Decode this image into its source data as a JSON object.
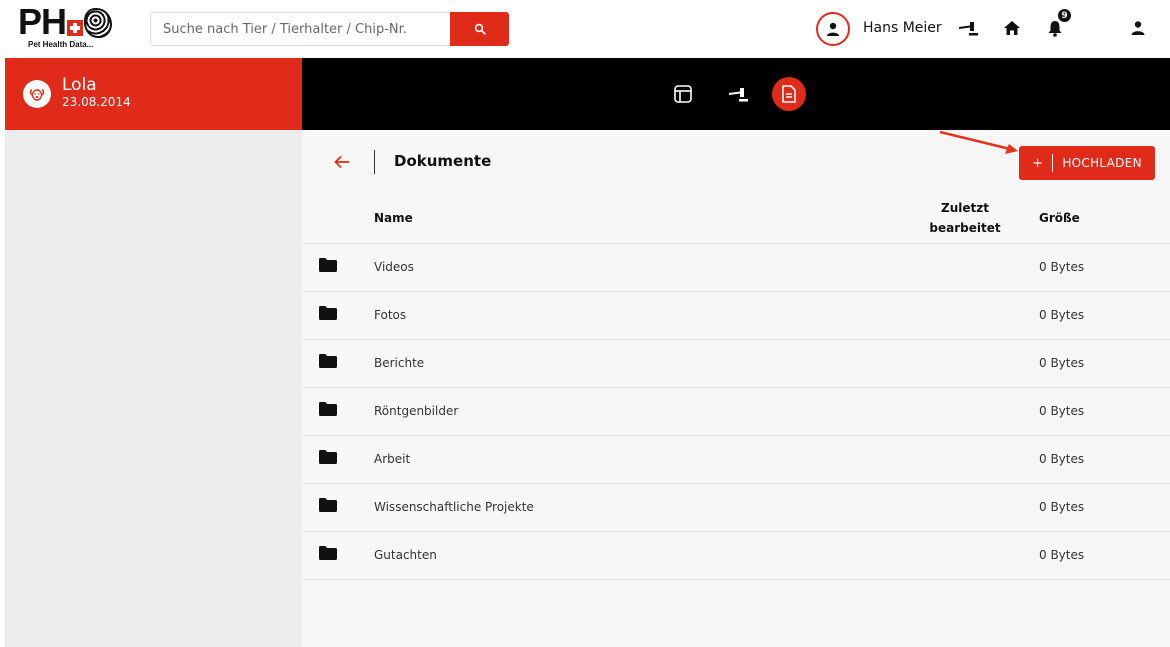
{
  "header": {
    "logo_text": "PH",
    "logo_subtitle": "Pet Health Data...",
    "search_placeholder": "Suche nach Tier / Tierhalter / Chip-Nr.",
    "user_name": "Hans Meier",
    "notification_count": "9",
    "accent_color": "#e02a1a"
  },
  "pet": {
    "name": "Lola",
    "birth_date": "23.08.2014"
  },
  "nav": {
    "items": [
      "dashboard-icon",
      "treatment-icon",
      "documents-icon"
    ],
    "active": "documents-icon"
  },
  "page": {
    "title": "Dokumente",
    "upload_plus": "+",
    "upload_label": "HOCHLADEN"
  },
  "table": {
    "columns": {
      "name": "Name",
      "modified_line1": "Zuletzt",
      "modified_line2": "bearbeitet",
      "size": "Größe"
    },
    "rows": [
      {
        "name": "Videos",
        "modified": "",
        "size": "0 Bytes"
      },
      {
        "name": "Fotos",
        "modified": "",
        "size": "0 Bytes"
      },
      {
        "name": "Berichte",
        "modified": "",
        "size": "0 Bytes"
      },
      {
        "name": "Röntgenbilder",
        "modified": "",
        "size": "0 Bytes"
      },
      {
        "name": "Arbeit",
        "modified": "",
        "size": "0 Bytes"
      },
      {
        "name": "Wissenschaftliche Projekte",
        "modified": "",
        "size": "0 Bytes"
      },
      {
        "name": "Gutachten",
        "modified": "",
        "size": "0 Bytes"
      }
    ]
  }
}
